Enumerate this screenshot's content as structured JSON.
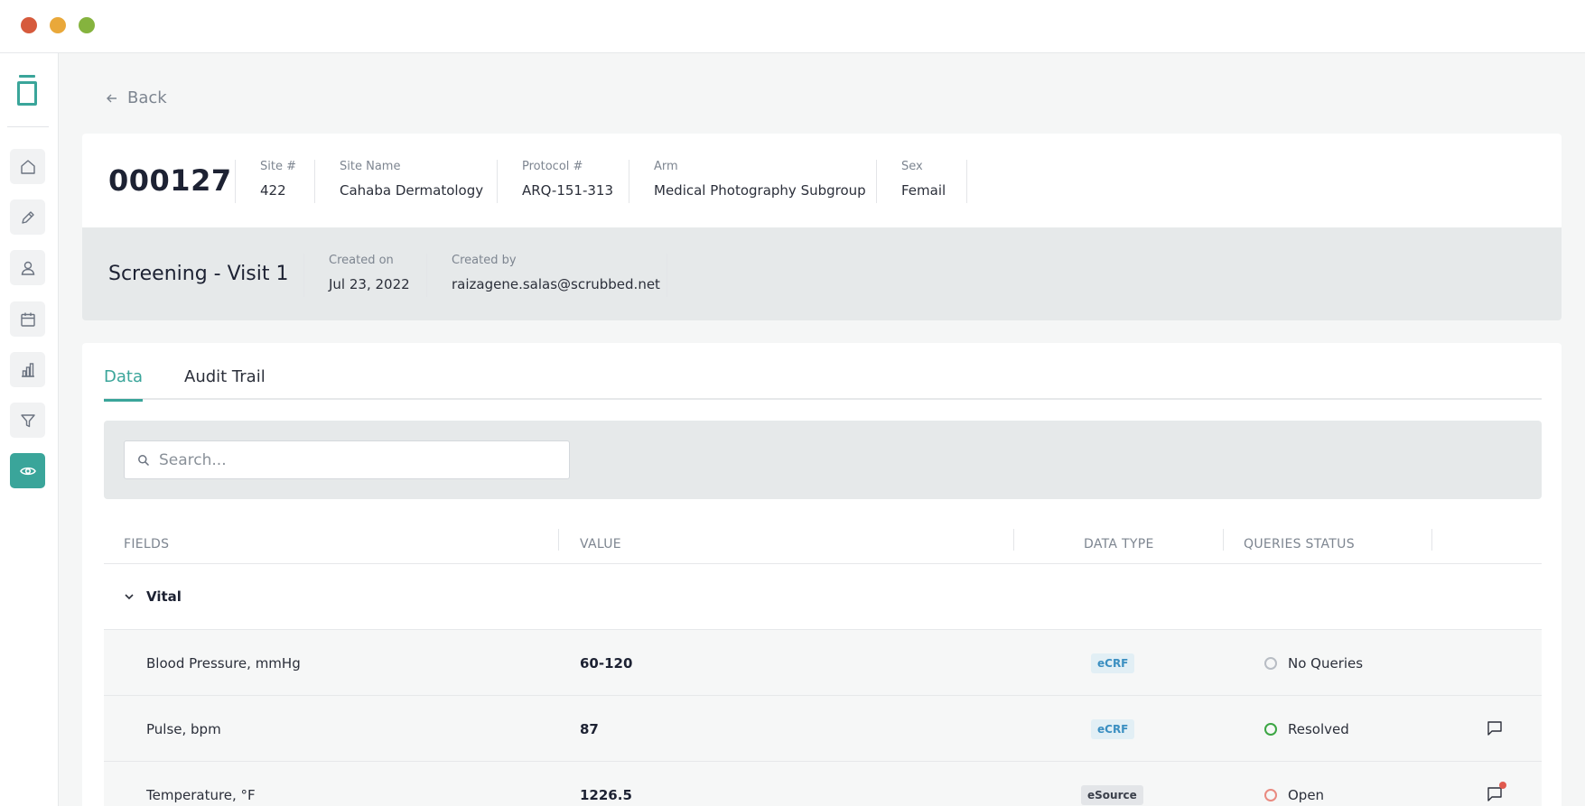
{
  "back_label": "Back",
  "patient": {
    "id": "000127",
    "fields": [
      {
        "label": "Site #",
        "value": "422"
      },
      {
        "label": "Site Name",
        "value": "Cahaba Dermatology"
      },
      {
        "label": "Protocol #",
        "value": "ARQ-151-313"
      },
      {
        "label": "Arm",
        "value": "Medical Photography Subgroup"
      },
      {
        "label": "Sex",
        "value": "Femail"
      }
    ]
  },
  "visit": {
    "title": "Screening - Visit 1",
    "created_on_label": "Created on",
    "created_on": "Jul 23, 2022",
    "created_by_label": "Created by",
    "created_by": "raizagene.salas@scrubbed.net"
  },
  "tabs": [
    {
      "label": "Data",
      "active": true
    },
    {
      "label": "Audit Trail",
      "active": false
    }
  ],
  "search": {
    "placeholder": "Search...",
    "value": ""
  },
  "table": {
    "columns": [
      "FIELDS",
      "VALUE",
      "DATA TYPE",
      "QUERIES STATUS"
    ],
    "group": "Vital",
    "rows": [
      {
        "field": "Blood Pressure, mmHg",
        "value": "60-120",
        "data_type": "eCRF",
        "status": "No Queries"
      },
      {
        "field": "Pulse, bpm",
        "value": "87",
        "data_type": "eCRF",
        "status": "Resolved"
      },
      {
        "field": "Temperature, °F",
        "value": "1226.5",
        "data_type": "eSource",
        "status": "Open"
      }
    ]
  },
  "sidebar_icons": [
    "home-icon",
    "pen-icon",
    "user-icon",
    "calendar-icon",
    "bar-chart-icon",
    "filter-icon",
    "eye-icon"
  ],
  "colors": {
    "accent": "#3aa59a",
    "resolved": "#3ca644",
    "open": "#e98a80",
    "ecrf": "#3b8fc1"
  }
}
